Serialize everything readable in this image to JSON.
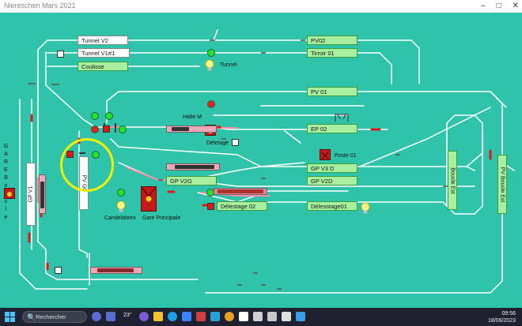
{
  "window": {
    "title": "Niereschen Mars 2021",
    "min_glyph": "–",
    "max_glyph": "□",
    "close_glyph": "✕"
  },
  "labels": {
    "tunnel_v2": "Tunnel V2",
    "tunnel_v1": "Tunnel V1#1",
    "coulisse": "Coulisse",
    "pv02": "PV02",
    "tirroir01": "Tirroir 01",
    "tunnel": "Tunnel",
    "pv01": "PV 01",
    "halte_m": "Halte M",
    "ep02": "EP 02",
    "detelage": "Dételage",
    "poste01": "Poste 01",
    "gpv3d": "GP V3 D",
    "gpv2g": "GP V2G",
    "gpv2d": "GP V2D",
    "pvg0": "PV G0",
    "gpv1": "GP V1",
    "delestage02": "Délestage 02",
    "delesstage01": "Délesstage01",
    "candelabres": "Candelabres",
    "gare_principale": "Gare Principale",
    "boucle_est": "Boucle Est",
    "pv_boucle_est": "PV Boucle Est",
    "gare_side": [
      "G",
      "A",
      "R",
      "E",
      " ",
      "B",
      "o",
      "u",
      "c",
      "l",
      "e"
    ]
  },
  "taskbar": {
    "search_placeholder": "Rechercher",
    "search_icon": "🔍",
    "weather": "23°",
    "time": "09:56",
    "date": "18/06/2023"
  },
  "colors": {
    "background": "#2fc4aa",
    "track": "#ffffff",
    "track_active": "#ff8aa8",
    "label_green": "#a8f0a0",
    "signal_green": "#22e22a",
    "signal_red": "#e52222",
    "highlight_ring": "#f2f200"
  }
}
